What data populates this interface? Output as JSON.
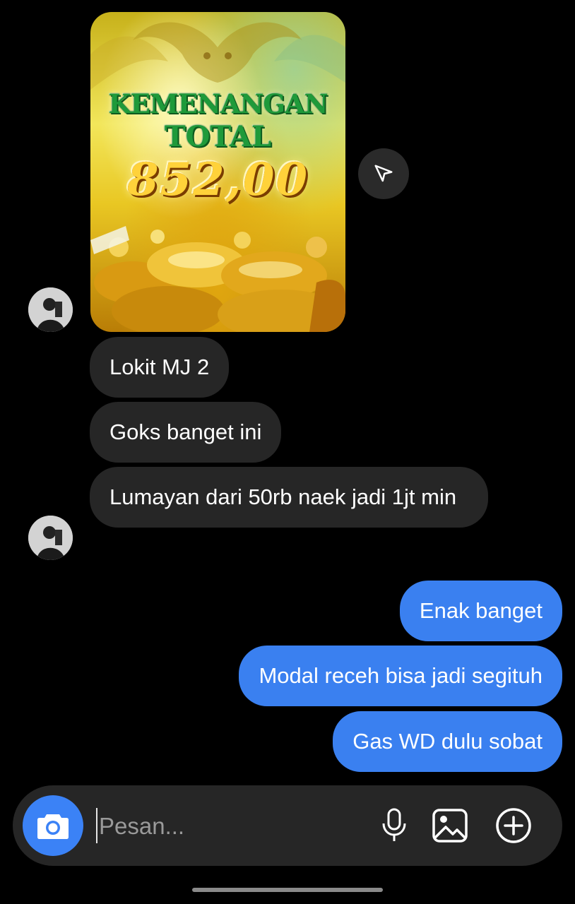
{
  "image_message": {
    "title_line1": "KEMENANGAN",
    "title_line2": "TOTAL",
    "amount": "852,00"
  },
  "share_button": {
    "icon": "send-icon"
  },
  "incoming_messages": [
    {
      "text": "Lokit MJ 2"
    },
    {
      "text": "Goks banget ini"
    },
    {
      "text": "Lumayan dari 50rb naek jadi 1jt min"
    }
  ],
  "outgoing_messages": [
    {
      "text": "Enak banget"
    },
    {
      "text": "Modal receh bisa jadi segituh"
    },
    {
      "text": "Gas WD dulu sobat"
    }
  ],
  "composer": {
    "placeholder": "Pesan...",
    "camera_icon": "camera-icon",
    "mic_icon": "microphone-icon",
    "gallery_icon": "image-icon",
    "more_icon": "plus-circle-icon"
  },
  "colors": {
    "background": "#000000",
    "incoming_bubble": "#262626",
    "outgoing_bubble": "#3a80f0",
    "accent": "#3b82f6"
  }
}
